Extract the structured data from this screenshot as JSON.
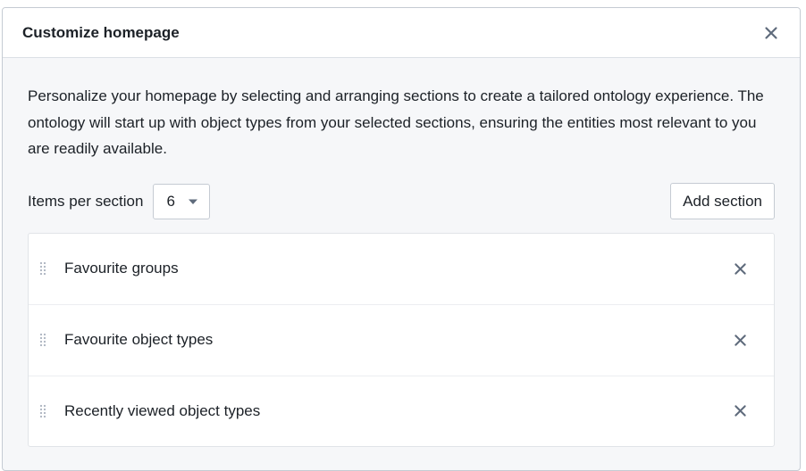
{
  "dialog": {
    "title": "Customize homepage",
    "description": "Personalize your homepage by selecting and arranging sections to create a tailored ontology experience. The ontology will start up with object types from your selected sections, ensuring the entities most relevant to you are readily available."
  },
  "controls": {
    "items_per_section_label": "Items per section",
    "items_per_section_value": "6",
    "add_section_label": "Add section"
  },
  "sections": [
    {
      "label": "Favourite groups"
    },
    {
      "label": "Favourite object types"
    },
    {
      "label": "Recently viewed object types"
    }
  ],
  "icons": {
    "close": "close-icon",
    "dropdown": "caret-down-icon",
    "drag": "drag-handle-icon",
    "remove": "remove-icon"
  },
  "colors": {
    "text": "#1c2127",
    "icon": "#5f6b7c",
    "drag": "#abb3bf",
    "border": "#c5cbd3",
    "body_bg": "#f6f7f9"
  }
}
